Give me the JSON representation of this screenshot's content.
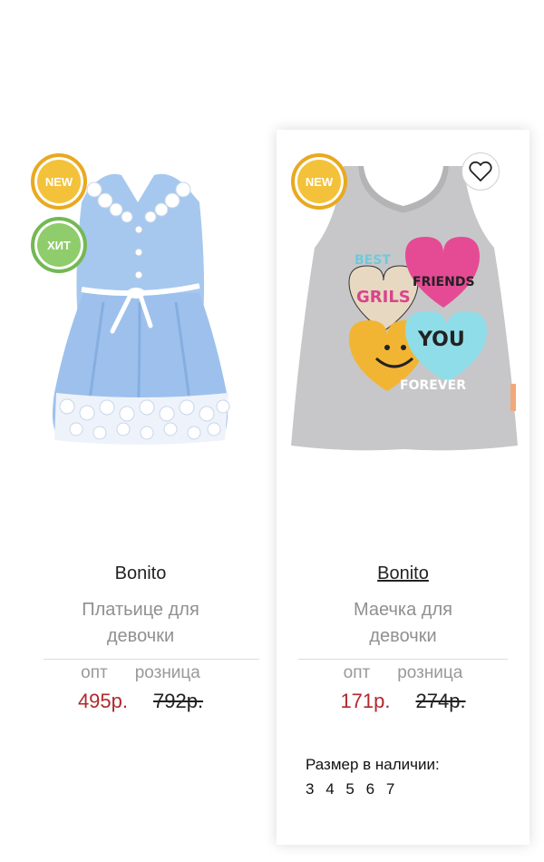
{
  "products": [
    {
      "badges": [
        "NEW",
        "ХИТ"
      ],
      "brand": "Bonito",
      "name_line1": "Платьице для",
      "name_line2": "девочки",
      "opt_label": "опт",
      "retail_label": "розница",
      "opt_price": "495р.",
      "retail_price": "792р.",
      "image_icon": "dress-image"
    },
    {
      "badges": [
        "NEW"
      ],
      "wishlist_icon": "heart-icon",
      "brand": "Bonito",
      "name_line1": "Маечка для",
      "name_line2": "девочки",
      "opt_label": "опт",
      "retail_label": "розница",
      "opt_price": "171р.",
      "retail_price": "274р.",
      "image_icon": "tank-top-image",
      "print_texts": [
        "BEST",
        "GRILS",
        "FRIENDS",
        "YOU",
        "FOREVER"
      ],
      "sizes_title": "Размер в наличии:",
      "sizes": [
        "3",
        "4",
        "5",
        "6",
        "7"
      ]
    }
  ],
  "colors": {
    "opt_price": "#b0292c",
    "badge_new": "#f3c23a",
    "badge_hit": "#8fcc6b",
    "dress": "#9fc3ec",
    "tank": "#c8c8ca"
  }
}
